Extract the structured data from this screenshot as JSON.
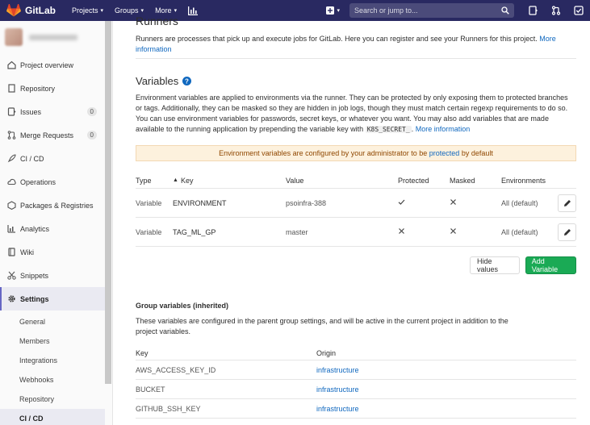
{
  "navbar": {
    "brand": "GitLab",
    "menu": [
      {
        "label": "Projects",
        "has_caret": true
      },
      {
        "label": "Groups",
        "has_caret": true
      },
      {
        "label": "More",
        "has_caret": true
      }
    ],
    "search_placeholder": "Search or jump to...",
    "bg_color": "#292961"
  },
  "sidebar": {
    "items": [
      {
        "label": "Project overview",
        "icon": "home-icon"
      },
      {
        "label": "Repository",
        "icon": "doc-icon"
      },
      {
        "label": "Issues",
        "icon": "issues-icon",
        "count": "0"
      },
      {
        "label": "Merge Requests",
        "icon": "merge-request-icon",
        "count": "0"
      },
      {
        "label": "CI / CD",
        "icon": "rocket-icon"
      },
      {
        "label": "Operations",
        "icon": "cloud-gear-icon"
      },
      {
        "label": "Packages & Registries",
        "icon": "package-icon"
      },
      {
        "label": "Analytics",
        "icon": "chart-icon"
      },
      {
        "label": "Wiki",
        "icon": "book-icon"
      },
      {
        "label": "Snippets",
        "icon": "scissors-icon"
      },
      {
        "label": "Settings",
        "icon": "gear-icon"
      }
    ],
    "settings_sub": [
      "General",
      "Members",
      "Integrations",
      "Webhooks",
      "Repository",
      "CI / CD"
    ]
  },
  "runners": {
    "title": "Runners",
    "text": "Runners are processes that pick up and execute jobs for GitLab. Here you can register and see your Runners for this project.",
    "link": "More information"
  },
  "variables": {
    "title": "Variables",
    "desc_part1": "Environment variables are applied to environments via the runner. They can be protected by only exposing them to protected branches or tags. Additionally, they can be masked so they are hidden in job logs, though they must match certain regexp requirements to do so. You can use environment variables for passwords, secret keys, or whatever you want. You may also add variables that are made available to the running application by prepending the variable key with",
    "desc_code": "K8S_SECRET_",
    "desc_end": ".",
    "desc_link": "More information",
    "alert_pre": "Environment variables are configured by your administrator to be",
    "alert_link": "protected",
    "alert_post": "by default",
    "headers": {
      "type": "Type",
      "key": "Key",
      "value": "Value",
      "protected": "Protected",
      "masked": "Masked",
      "environments": "Environments"
    },
    "rows": [
      {
        "type": "Variable",
        "key": "ENVIRONMENT",
        "value": "psoinfra-388",
        "protected": "check",
        "masked": "cross",
        "env": "All (default)"
      },
      {
        "type": "Variable",
        "key": "TAG_ML_GP",
        "value": "master",
        "protected": "cross",
        "masked": "cross",
        "env": "All (default)"
      }
    ],
    "hide_button": "Hide values",
    "add_button": "Add Variable"
  },
  "group_vars": {
    "title": "Group variables (inherited)",
    "desc": "These variables are configured in the parent group settings, and will be active in the current project in addition to the project variables.",
    "headers": {
      "key": "Key",
      "origin": "Origin"
    },
    "rows": [
      {
        "key": "AWS_ACCESS_KEY_ID",
        "origin": "infrastructure"
      },
      {
        "key": "BUCKET",
        "origin": "infrastructure"
      },
      {
        "key": "GITHUB_SSH_KEY",
        "origin": "infrastructure"
      }
    ]
  },
  "colors": {
    "accent": "#1aaa55",
    "link": "#1068bf",
    "alert_bg": "#fdf1dd"
  }
}
